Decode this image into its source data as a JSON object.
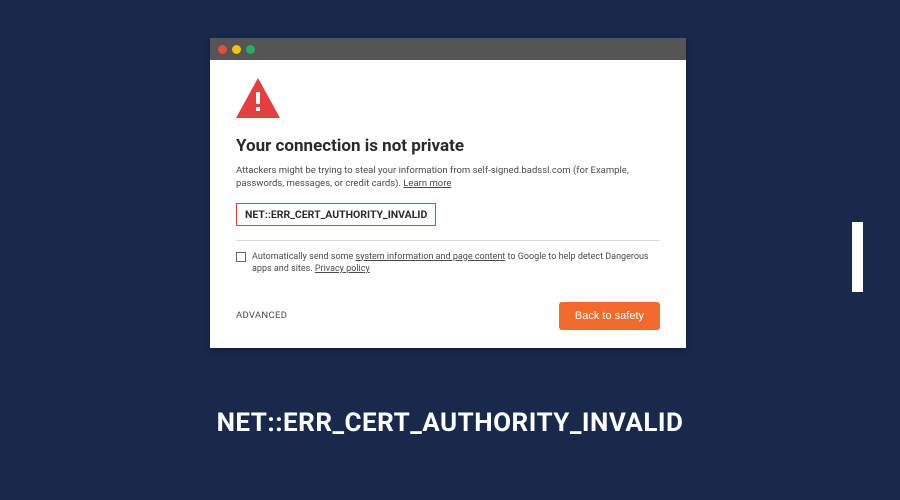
{
  "window": {
    "heading": "Your connection is not private",
    "subtext_pre": "Attackers might be trying to steal your information from self-signed.badssl.com (for Example, passwords, messages, or credit cards). ",
    "learn_more": "Learn more",
    "error_code": "NET::ERR_CERT_AUTHORITY_INVALID",
    "consent_pre": "Automatically send some ",
    "consent_link1": "system information and page content",
    "consent_mid": " to Google to help detect Dangerous apps and sites. ",
    "consent_link2": "Privacy policy",
    "advanced_label": "ADVANCED",
    "safety_label": "Back to safety"
  },
  "caption": "NET::ERR_CERT_AUTHORITY_INVALID"
}
